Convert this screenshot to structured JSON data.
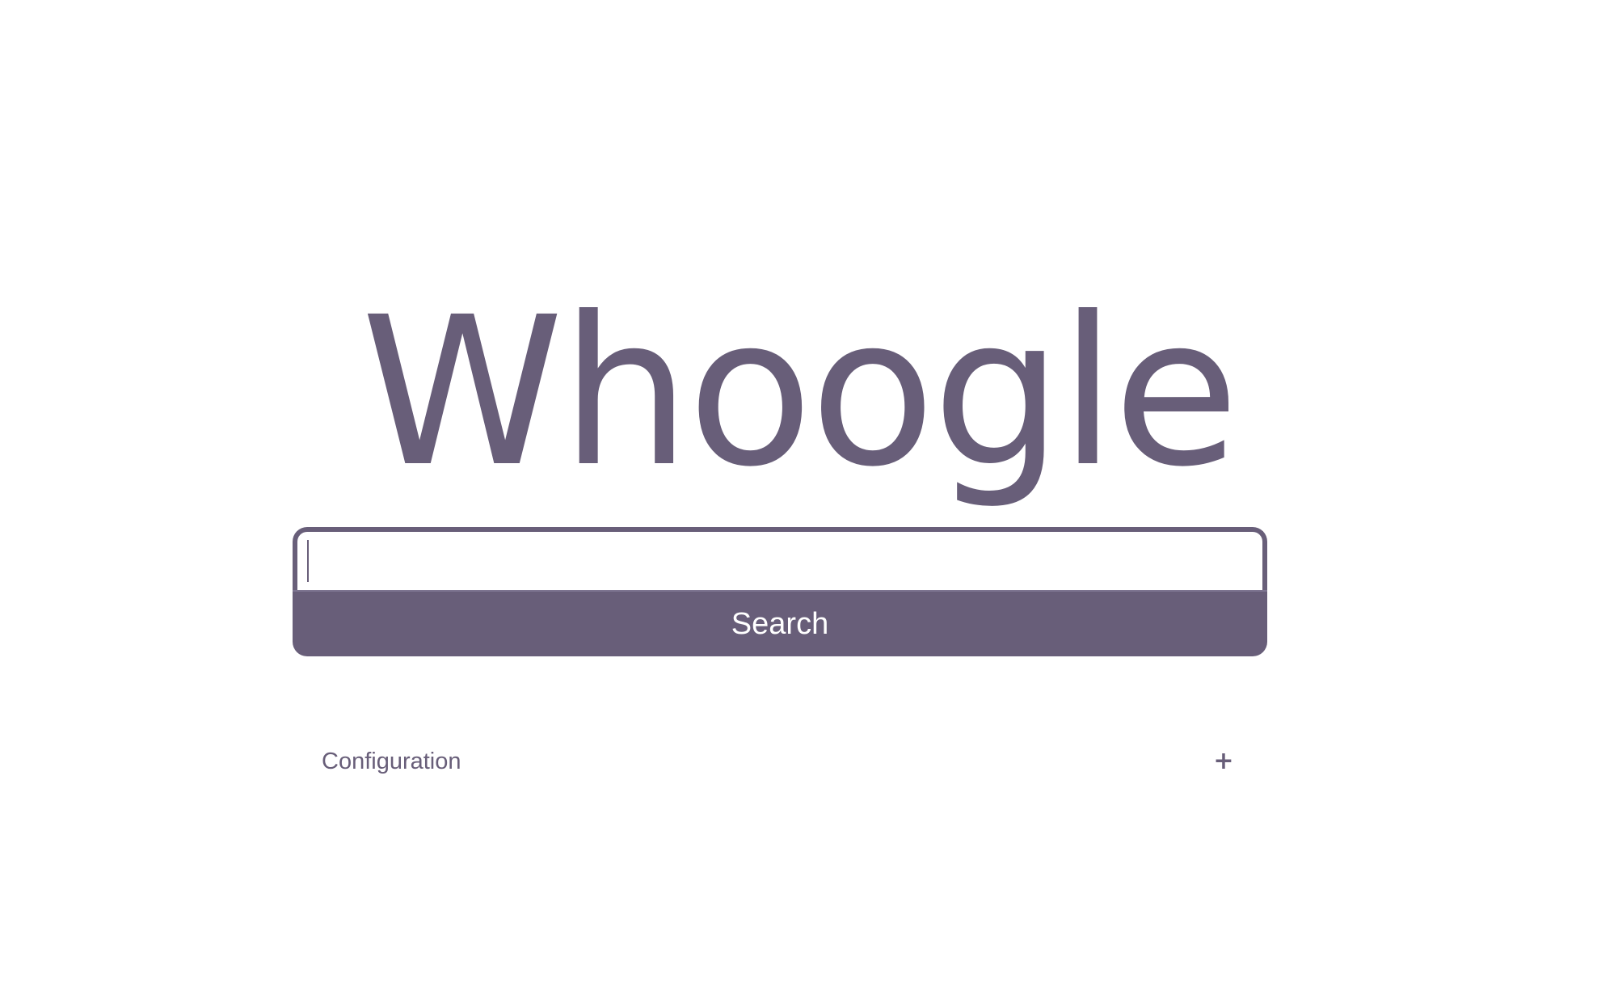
{
  "logo": {
    "text": "Whoogle"
  },
  "search": {
    "input_value": "",
    "placeholder": "",
    "button_label": "Search"
  },
  "config": {
    "label": "Configuration",
    "toggle_icon": "+",
    "toggle_icon_name": "plus-icon"
  },
  "colors": {
    "accent": "#685e79",
    "background": "#ffffff",
    "button_text": "#ffffff"
  }
}
